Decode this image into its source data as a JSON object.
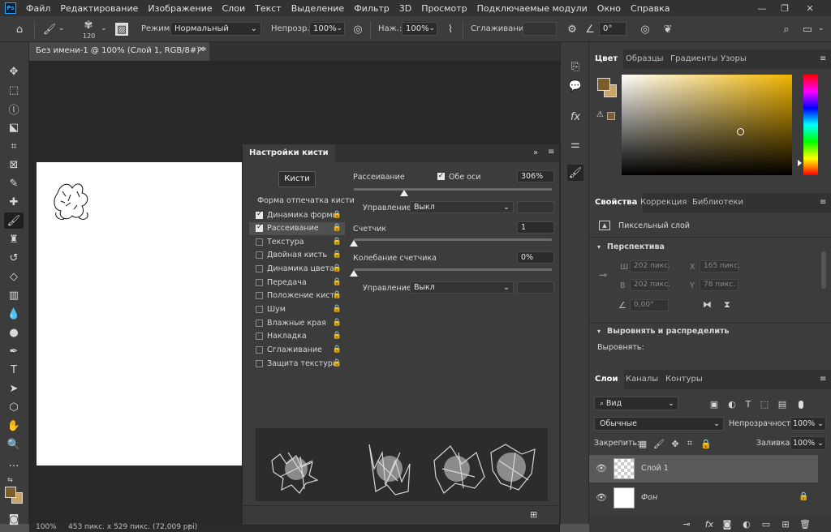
{
  "app": {
    "logo_text": "Ps"
  },
  "menu": [
    "Файл",
    "Редактирование",
    "Изображение",
    "Слои",
    "Текст",
    "Выделение",
    "Фильтр",
    "3D",
    "Просмотр",
    "Подключаемые модули",
    "Окно",
    "Справка"
  ],
  "window_controls": {
    "minimize": "—",
    "restore": "❐",
    "close": "✕"
  },
  "options_bar": {
    "brush_size": "120",
    "mode_label": "Режим:",
    "mode_value": "Нормальный",
    "opacity_label": "Непрозр.:",
    "opacity_value": "100%",
    "flow_label": "Наж.:",
    "flow_value": "100%",
    "smoothing_label": "Сглаживание:",
    "angle_value": "0°"
  },
  "document": {
    "tab_title": "Без имени-1 @ 100% (Слой 1, RGB/8#) *",
    "zoom": "100%",
    "info": "453 пикс. x 529 пикс. (72,009 ppi)"
  },
  "brush_panel": {
    "title": "Настройки кисти",
    "brushes_button": "Кисти",
    "section_header": "Форма отпечатка кисти",
    "items": [
      {
        "label": "Динамика формы",
        "checked": true
      },
      {
        "label": "Рассеивание",
        "checked": true
      },
      {
        "label": "Текстура",
        "checked": false
      },
      {
        "label": "Двойная кисть",
        "checked": false
      },
      {
        "label": "Динамика цвета",
        "checked": false
      },
      {
        "label": "Передача",
        "checked": false
      },
      {
        "label": "Положение кисти",
        "checked": false
      },
      {
        "label": "Шум",
        "checked": false
      },
      {
        "label": "Влажные края",
        "checked": false
      },
      {
        "label": "Накладка",
        "checked": false
      },
      {
        "label": "Сглаживание",
        "checked": false
      },
      {
        "label": "Защита текстуры",
        "checked": false
      }
    ],
    "scatter_label": "Рассеивание",
    "both_axes_label": "Обе оси",
    "scatter_value": "306%",
    "scatter_fraction": 0.255,
    "control_label": "Управление:",
    "control_value": "Выкл",
    "count_label": "Счетчик",
    "count_value": "1",
    "count_jitter_label": "Колебание счетчика",
    "count_jitter_value": "0%",
    "control2_label": "Управление:",
    "control2_value": "Выкл"
  },
  "color_panel": {
    "tabs": [
      "Цвет",
      "Образцы",
      "Градиенты",
      "Узоры"
    ],
    "foreground": "#7a5f2b",
    "background": "#c7a56b",
    "hue_color": "#f0b400"
  },
  "properties_panel": {
    "tabs": [
      "Свойства",
      "Коррекция",
      "Библиотеки"
    ],
    "layer_type": "Пиксельный слой",
    "perspective_header": "Перспектива",
    "w_label": "Ш",
    "w_value": "202 пикс.",
    "h_label": "В",
    "h_value": "202 пикс.",
    "x_label": "X",
    "x_value": "165 пикс.",
    "y_label": "Y",
    "y_value": "78 пикс.",
    "angle_value": "0,00°",
    "align_header": "Выровнять и распределить",
    "align_label": "Выровнять:"
  },
  "layers_panel": {
    "tabs": [
      "Слои",
      "Каналы",
      "Контуры"
    ],
    "filter_value": "Вид",
    "blend_value": "Обычные",
    "opacity_label": "Непрозрачность:",
    "opacity_value": "100%",
    "lock_label": "Закрепить:",
    "fill_label": "Заливка:",
    "fill_value": "100%",
    "layers": [
      {
        "name": "Слой 1",
        "selected": true
      },
      {
        "name": "Фон",
        "selected": false
      }
    ]
  }
}
